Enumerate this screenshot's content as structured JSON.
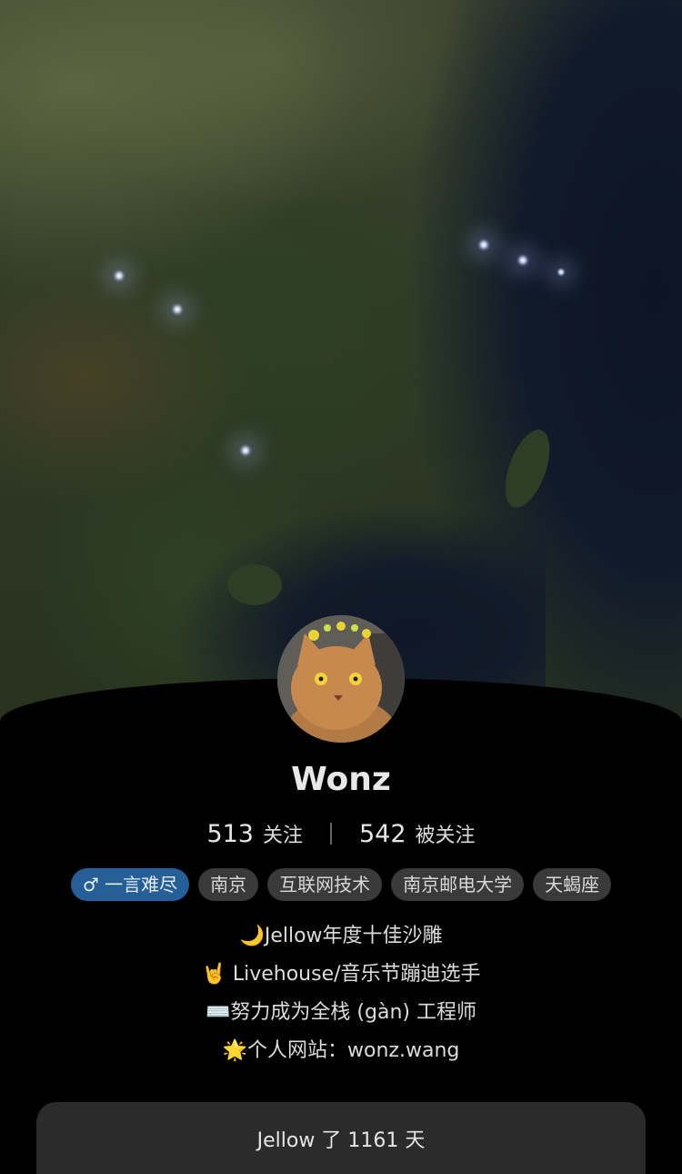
{
  "profile": {
    "name": "Wonz",
    "following_count": "513",
    "following_label": "关注",
    "followers_count": "542",
    "followers_label": "被关注",
    "avatar_icon": "cat-avatar",
    "header_image": "satellite-map-night"
  },
  "tags": [
    {
      "label": "♂ 一言难尽",
      "type": "gender"
    },
    {
      "label": "南京"
    },
    {
      "label": "互联网技术"
    },
    {
      "label": "南京邮电大学"
    },
    {
      "label": "天蝎座"
    }
  ],
  "bio": [
    "🌙Jellow年度十佳沙雕",
    "🤘 Livehouse/音乐节蹦迪选手",
    "⌨️努力成为全栈 (gàn) 工程师",
    "🌟个人网站：wonz.wang"
  ],
  "days_banner": {
    "label": "Jellow 了 1161 天"
  },
  "colors": {
    "background": "#000000",
    "gender_tag": "#265f98",
    "tag": "#3a3a3a",
    "banner": "#2b2b2b"
  }
}
